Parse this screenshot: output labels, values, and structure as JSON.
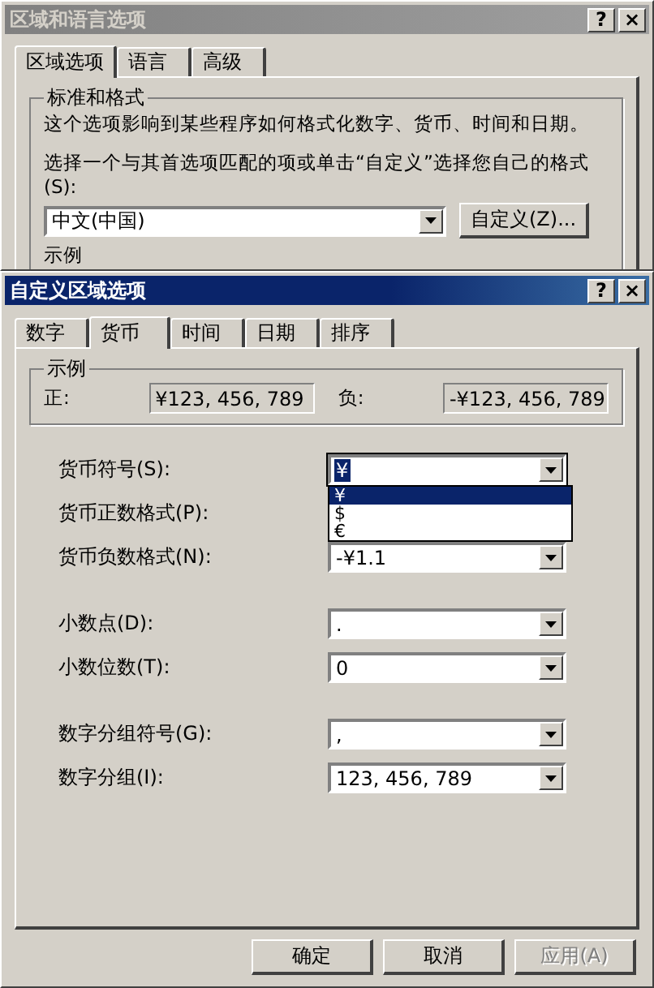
{
  "back_window": {
    "title": "区域和语言选项",
    "title_buttons": [
      "?",
      "×"
    ],
    "tabs": [
      {
        "label": "区域选项",
        "selected": true
      },
      {
        "label": "语言",
        "selected": false
      },
      {
        "label": "高级",
        "selected": false
      }
    ],
    "group": {
      "title": "标准和格式",
      "description": "这个选项影响到某些程序如何格式化数字、货币、时间和日期。",
      "prompt": "选择一个与其首选项匹配的项或单击“自定义”选择您自己的格式(S):",
      "format": "中文(中国)",
      "customize_button": "自定义(Z)..."
    },
    "sample_label": "示例"
  },
  "front_window": {
    "title": "自定义区域选项",
    "title_buttons": [
      "?",
      "×"
    ],
    "tabs": [
      {
        "label": "数字",
        "selected": false
      },
      {
        "label": "货币",
        "selected": true
      },
      {
        "label": "时间",
        "selected": false
      },
      {
        "label": "日期",
        "selected": false
      },
      {
        "label": "排序",
        "selected": false
      }
    ],
    "sample": {
      "title": "示例",
      "positive_label": "正:",
      "positive": "¥123, 456, 789",
      "negative_label": "负:",
      "negative": "-¥123, 456, 789"
    },
    "field_groups": [
      [
        {
          "label": "货币符号(S):",
          "value": "¥",
          "focused": true,
          "open": true
        },
        {
          "label": "货币正数格式(P):"
        },
        {
          "label": "货币负数格式(N):",
          "value": "-¥1.1",
          "focused": false
        }
      ],
      [
        {
          "label": "小数点(D):",
          "value": ".",
          "focused": false
        },
        {
          "label": "小数位数(T):",
          "value": "0",
          "focused": false
        }
      ],
      [
        {
          "label": "数字分组符号(G):",
          "value": ",",
          "focused": false
        },
        {
          "label": "数字分组(I):",
          "value": "123, 456, 789",
          "focused": false
        }
      ]
    ],
    "dropdown": {
      "options": [
        {
          "label": "¥",
          "selected": true
        },
        {
          "label": "$",
          "selected": false
        },
        {
          "label": "€",
          "selected": false
        }
      ]
    },
    "buttons": [
      {
        "label": "确定",
        "disabled": false
      },
      {
        "label": "取消",
        "disabled": false
      },
      {
        "label": "应用(A)",
        "disabled": true
      }
    ]
  }
}
